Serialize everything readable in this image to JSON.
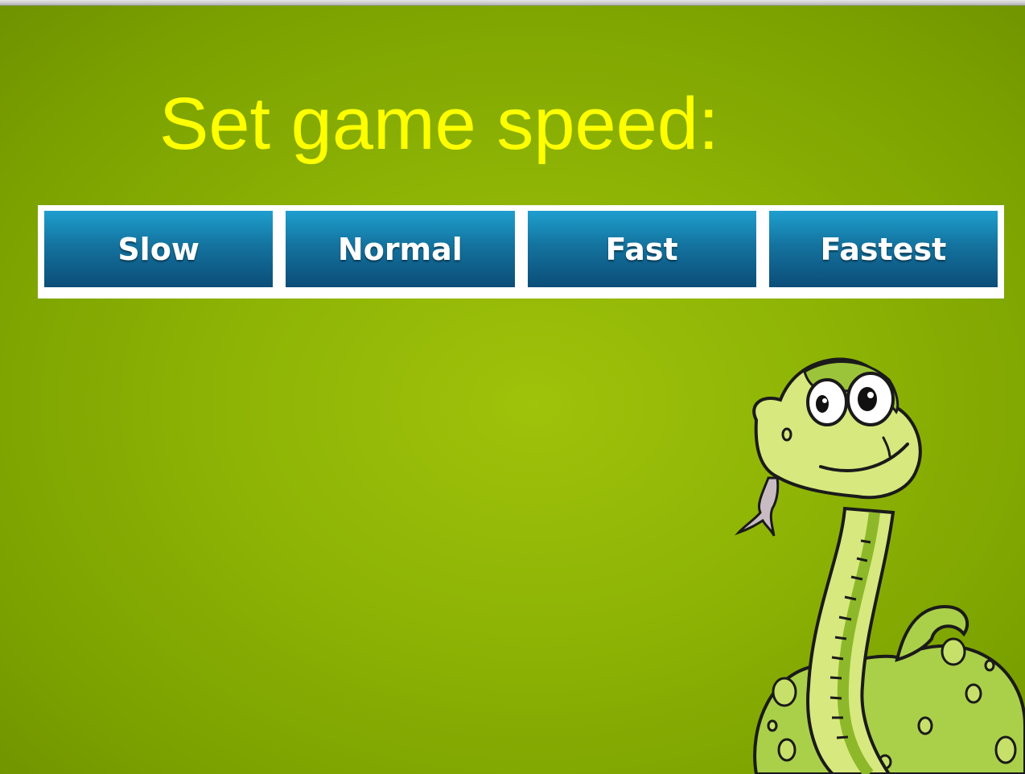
{
  "screen": {
    "title": "Set game speed:",
    "speed_options": [
      {
        "label": "Slow"
      },
      {
        "label": "Normal"
      },
      {
        "label": "Fast"
      },
      {
        "label": "Fastest"
      }
    ],
    "mascot": "cartoon-snake"
  },
  "colors": {
    "background": "#8db305",
    "title_text": "#ffff00",
    "button_top": "#1e9fce",
    "button_bottom": "#0b4d78",
    "button_text": "#ffffff",
    "button_frame": "#ffffff"
  }
}
